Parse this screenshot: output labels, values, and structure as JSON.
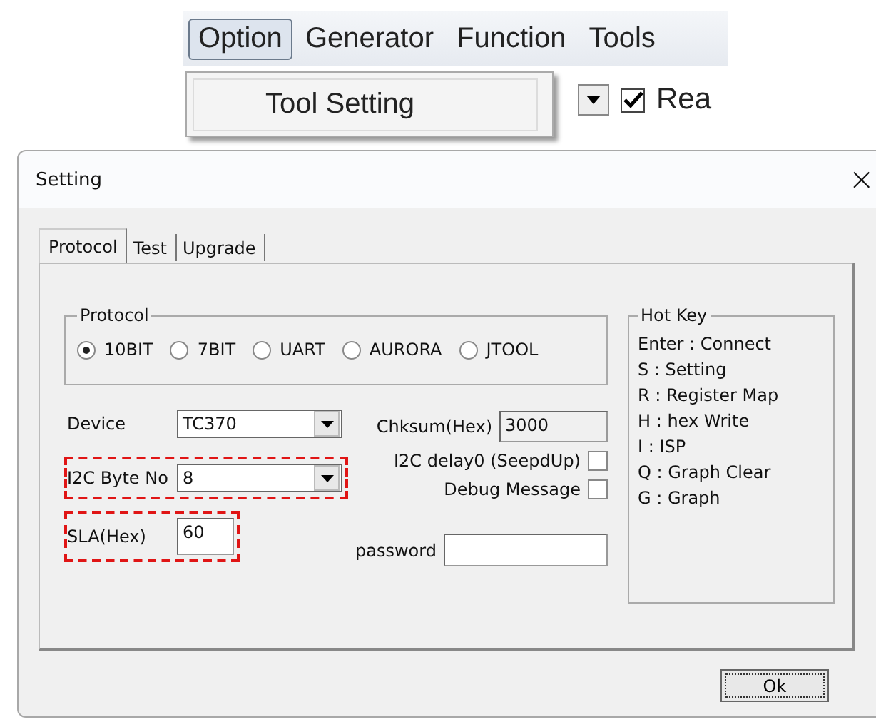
{
  "menubar": {
    "items": [
      {
        "label": "Option",
        "selected": true
      },
      {
        "label": "Generator",
        "selected": false
      },
      {
        "label": "Function",
        "selected": false
      },
      {
        "label": "Tools",
        "selected": false
      }
    ],
    "dropdown": {
      "items": [
        "Tool Setting"
      ]
    },
    "toolbar": {
      "checkbox": {
        "label": "Rea",
        "checked": true
      }
    }
  },
  "dialog": {
    "title": "Setting",
    "close": "×",
    "tabs": [
      {
        "label": "Protocol",
        "selected": true
      },
      {
        "label": "Test",
        "selected": false
      },
      {
        "label": "Upgrade",
        "selected": false
      }
    ],
    "protocol_group": {
      "title": "Protocol",
      "options": [
        {
          "label": "10BIT",
          "selected": true
        },
        {
          "label": "7BIT",
          "selected": false
        },
        {
          "label": "UART",
          "selected": false
        },
        {
          "label": "AURORA",
          "selected": false
        },
        {
          "label": "JTOOL",
          "selected": false
        }
      ]
    },
    "fields": [
      {
        "kind": "combo",
        "label": "Device",
        "value": "TC370",
        "highlighted": false
      },
      {
        "kind": "combo",
        "label": "I2C Byte No",
        "value": "8",
        "highlighted": true
      },
      {
        "kind": "text",
        "label": "SLA(Hex)",
        "value": "60",
        "highlighted": true
      }
    ],
    "chksum": {
      "label": "Chksum(Hex)",
      "value": "3000",
      "disabled": true
    },
    "checkboxes": [
      {
        "label": "I2C delay0 (SeepdUp)",
        "checked": false
      },
      {
        "label": "Debug Message",
        "checked": false
      }
    ],
    "password": {
      "label": "password"
    },
    "hotkey_group": {
      "title": "Hot Key",
      "lines": [
        "Enter : Connect",
        "S : Setting",
        "R : Register Map",
        "H : hex Write",
        "I  : ISP",
        "Q : Graph Clear",
        "G : Graph"
      ]
    },
    "ok_button": "Ok"
  }
}
